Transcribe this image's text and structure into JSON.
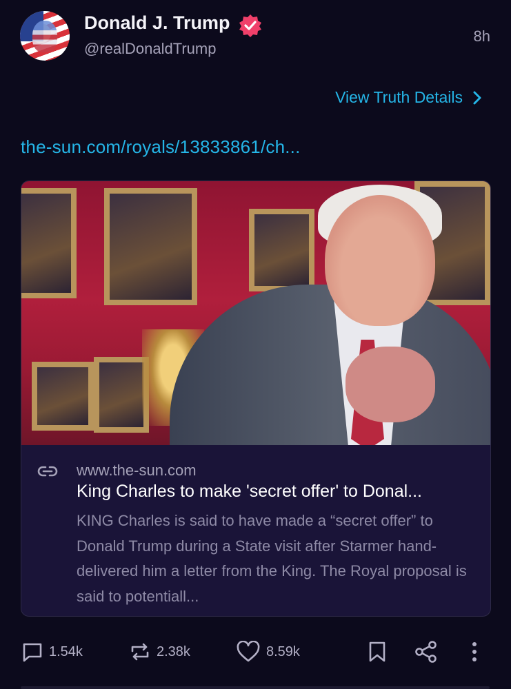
{
  "author": {
    "name": "Donald J. Trump",
    "handle": "@realDonaldTrump",
    "verified": true
  },
  "post": {
    "time": "8h",
    "view_details_label": "View Truth Details",
    "link_text": "the-sun.com/royals/13833861/ch..."
  },
  "card": {
    "domain": "www.the-sun.com",
    "title": "King Charles to make 'secret offer' to Donal...",
    "description": "KING Charles is said to have made a “secret offer” to Donald Trump during a State visit after Starmer hand-delivered him a letter from the King. The Royal proposal is said to potentiall..."
  },
  "actions": {
    "replies": "1.54k",
    "retruths": "2.38k",
    "likes": "8.59k"
  },
  "colors": {
    "background": "#0c0a1c",
    "accent_link": "#25b6e8",
    "verified_badge": "#f0406a",
    "card_background": "#1a1438",
    "muted_text": "#a5a2b8"
  },
  "icons": [
    "verified-badge-icon",
    "chevron-right-icon",
    "link-icon",
    "reply-icon",
    "retruth-icon",
    "heart-icon",
    "bookmark-icon",
    "share-icon",
    "more-vertical-icon"
  ]
}
